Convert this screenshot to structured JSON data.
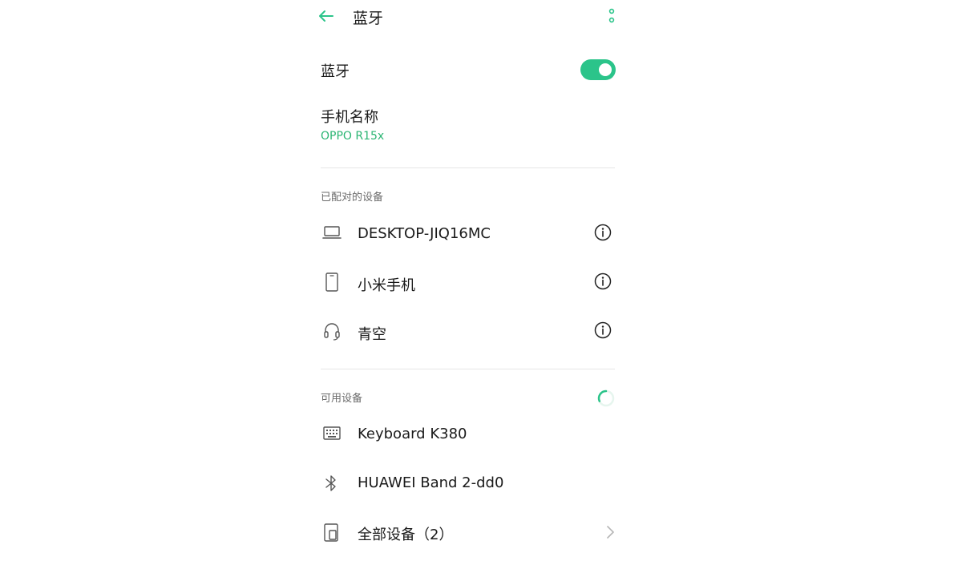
{
  "header": {
    "title": "蓝牙",
    "back_icon": "arrow-left-icon",
    "more_icon": "more-vertical-icon"
  },
  "bluetooth_toggle": {
    "label": "蓝牙",
    "enabled": true
  },
  "phone_name": {
    "label": "手机名称",
    "value": "OPPO R15x"
  },
  "paired": {
    "title": "已配对的设备",
    "devices": [
      {
        "name": "DESKTOP-JIQ16MC",
        "icon": "laptop-icon"
      },
      {
        "name": "小米手机",
        "icon": "phone-icon"
      },
      {
        "name": "青空",
        "icon": "headset-icon"
      }
    ]
  },
  "available": {
    "title": "可用设备",
    "devices": [
      {
        "name": "Keyboard K380",
        "icon": "keyboard-icon"
      },
      {
        "name": "HUAWEI Band 2-dd0",
        "icon": "bluetooth-icon"
      },
      {
        "name": "全部设备（2）",
        "icon": "devices-icon"
      }
    ]
  },
  "colors": {
    "accent": "#2bc48a",
    "accent_text": "#2bb573"
  }
}
